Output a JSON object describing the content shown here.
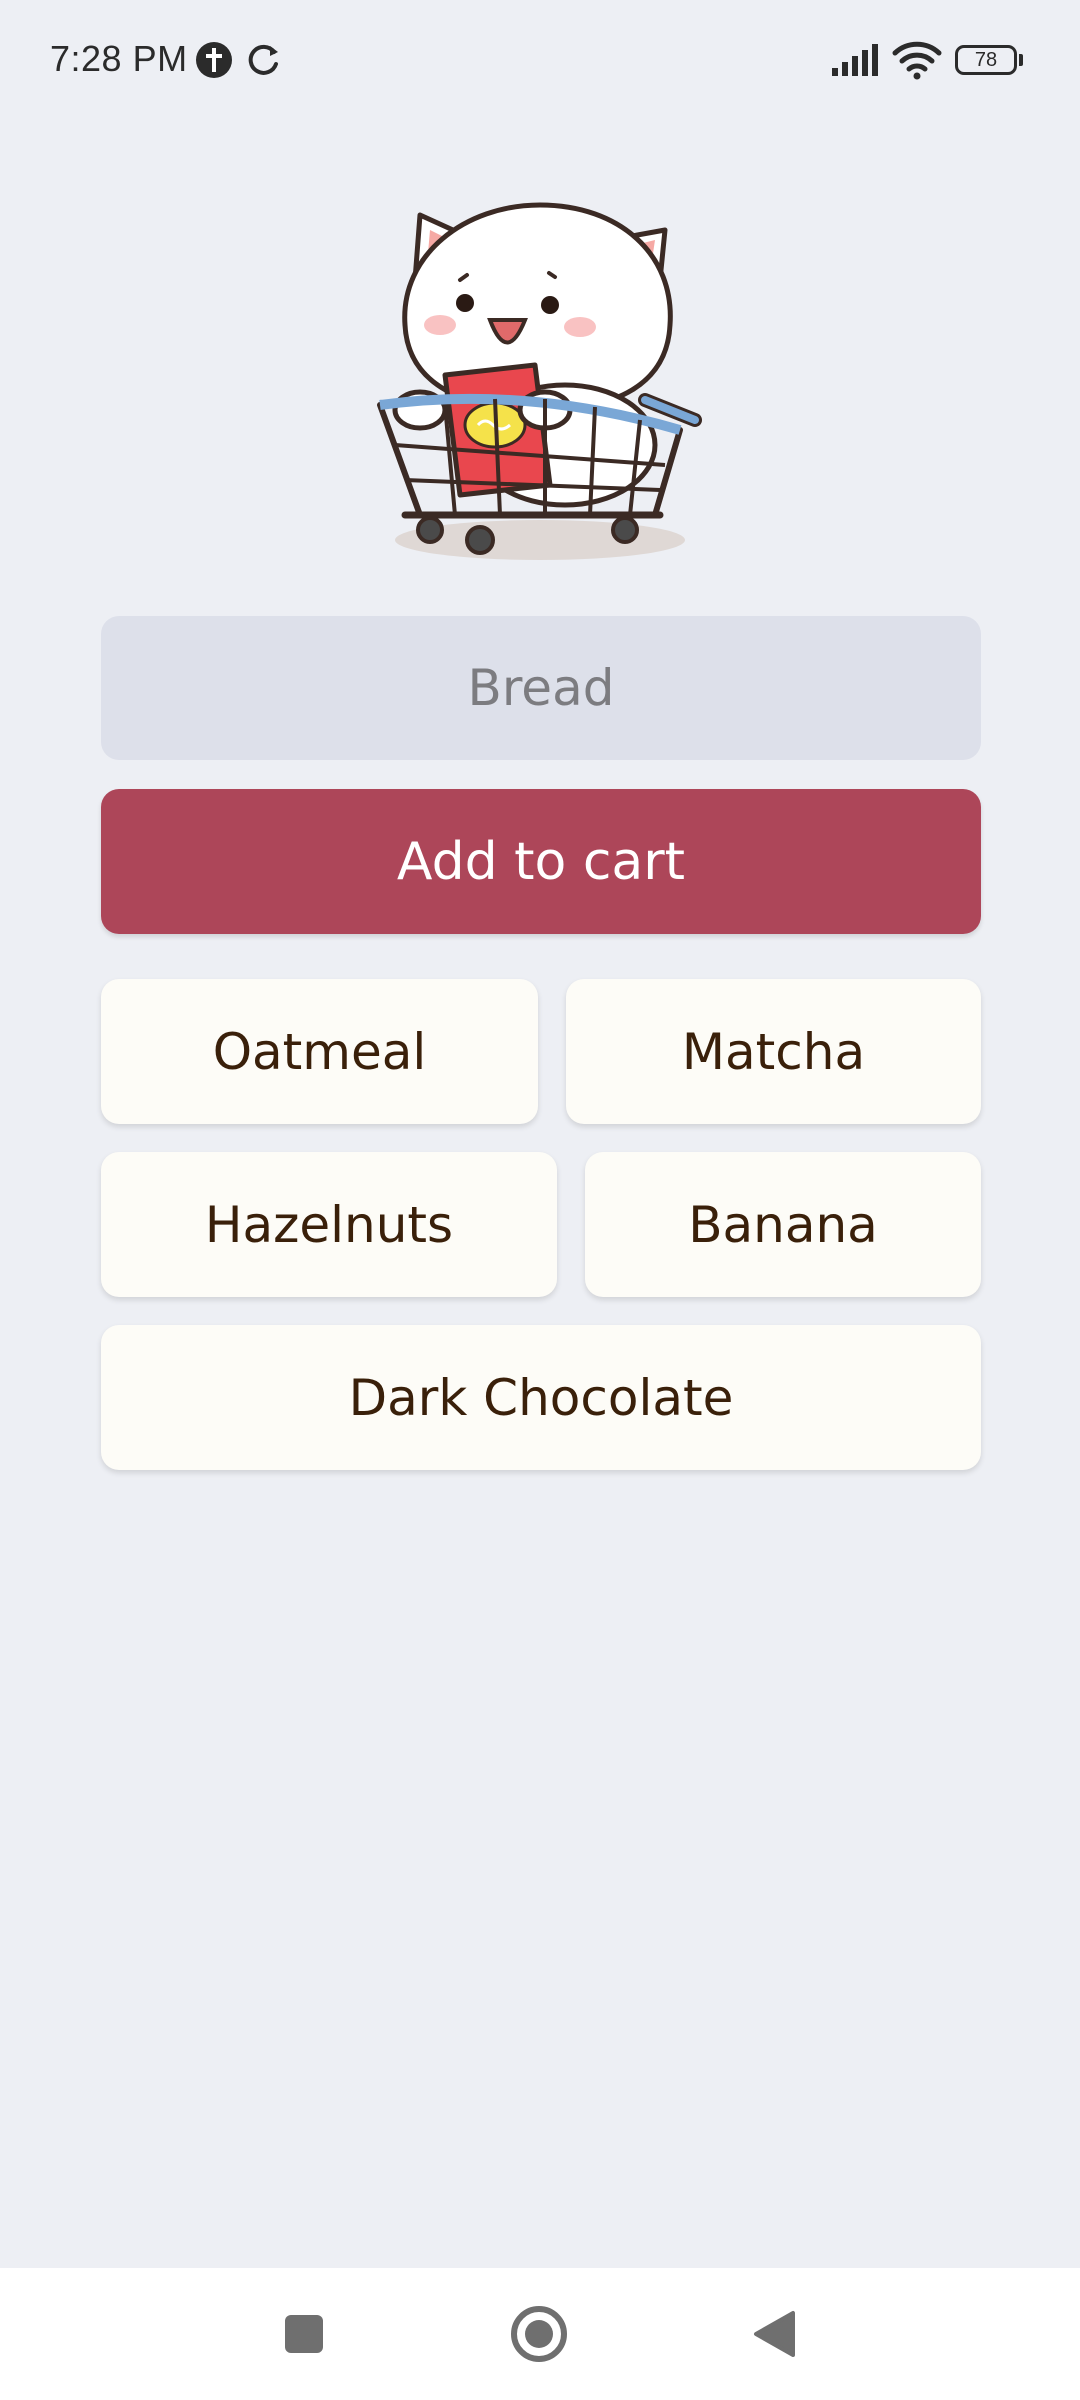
{
  "status_bar": {
    "time": "7:28 PM",
    "battery_level": "78",
    "icons": [
      "notification-icon",
      "sync-icon",
      "signal-icon",
      "wifi-icon",
      "battery-icon"
    ]
  },
  "mascot": {
    "icon": "cat-in-shopping-cart-icon"
  },
  "input": {
    "value": "",
    "placeholder": "Bread"
  },
  "add_button": {
    "label": "Add to cart"
  },
  "suggestions": [
    {
      "label": "Oatmeal"
    },
    {
      "label": "Matcha"
    },
    {
      "label": "Hazelnuts"
    },
    {
      "label": "Banana"
    },
    {
      "label": "Dark Chocolate"
    }
  ],
  "nav_bar": {
    "icons": [
      "recents-square-icon",
      "home-circle-icon",
      "back-triangle-icon"
    ]
  },
  "colors": {
    "background": "#edeff4",
    "input_bg": "#dde0ea",
    "accent": "#ad4659",
    "chip_bg": "#fdfcf7",
    "chip_text": "#3a200a"
  }
}
